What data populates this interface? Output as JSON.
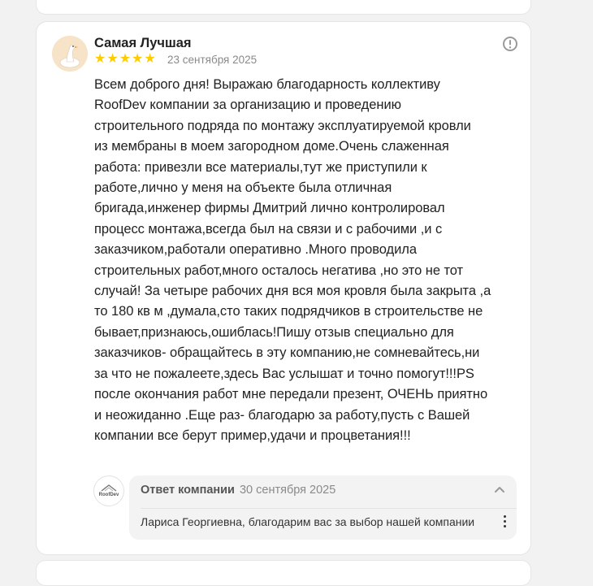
{
  "review": {
    "author": "Самая Лучшая",
    "avatar_icon": "goose-avatar-icon",
    "rating": 5,
    "rating_max": 5,
    "date": "23 сентября 2025",
    "report_icon": "exclamation-circle-icon",
    "text": "Всем доброго дня! Выражаю благодарность коллективу\nRoofDev компании за организацию и проведению\nстроительного подряда по монтажу эксплуатируемой кровли\nиз мембраны в моем загородном доме.Очень слаженная\nработа: привезли все материалы,тут же приступили к\nработе,лично у меня на объекте была отличная\nбригада,инженер фирмы Дмитрий лично контролировал\nпроцесс монтажа,всегда был на связи и с рабочими ,и с\nзаказчиком,работали оперативно .Много проводила\nстроительных работ,много осталось негатива ,но это не тот\nслучай! За четыре рабочих дня вся моя кровля была закрыта ,а\nто 180 кв м ,думала,сто таких подрядчиков в строительстве не\nбывает,признаюсь,ошиблась!Пишу отзыв специально для\nзаказчиков- обращайтесь в эту компанию,не сомневайтесь,ни\nза что не пожалеете,здесь Вас услышат и точно помогут!!!PS\nпосле окончания работ мне передали презент, ОЧЕНЬ приятно\nи неожиданно .Еще раз- благодарю за работу,пусть с Вашей\nкомпании все берут пример,удачи и процветания!!!"
  },
  "reply": {
    "company_logo_text": "RoofDev",
    "label": "Ответ компании",
    "date": "30 сентября 2025",
    "text": "Лариса Георгиевна, благодарим вас за выбор нашей компании",
    "collapse_icon": "chevron-up-icon",
    "menu_icon": "more-vertical-icon"
  },
  "colors": {
    "star": "#ffcc00",
    "card_border": "#e4e4e4",
    "reply_bg": "#f3f3f3",
    "muted_text": "#8a8a8a"
  }
}
